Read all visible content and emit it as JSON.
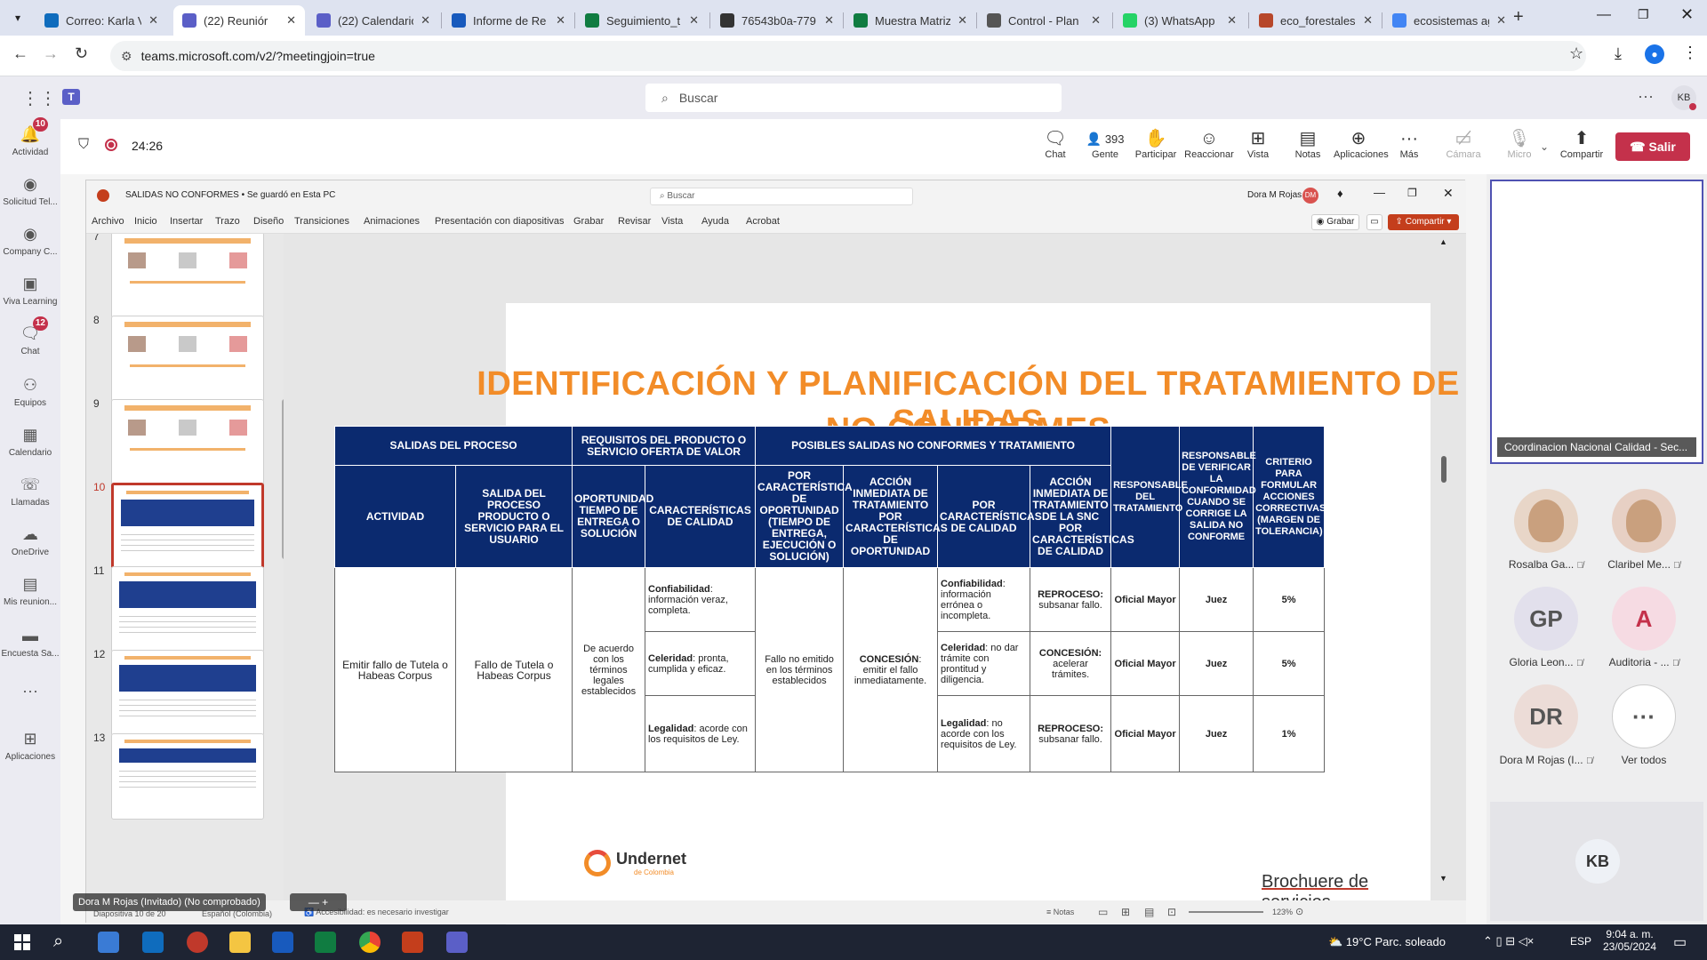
{
  "browser": {
    "tabs": [
      {
        "title": "Correo: Karla V",
        "color": "#0f6cbd",
        "active": false
      },
      {
        "title": "(22) Reuniór",
        "color": "#5b5fc7",
        "active": true
      },
      {
        "title": "(22) Calendario",
        "color": "#5b5fc7",
        "active": false
      },
      {
        "title": "Informe de Re",
        "color": "#185abd",
        "active": false
      },
      {
        "title": "Seguimiento_t",
        "color": "#107c41",
        "active": false
      },
      {
        "title": "76543b0a-779",
        "color": "#333333",
        "active": false
      },
      {
        "title": "Muestra Matriz",
        "color": "#107c41",
        "active": false
      },
      {
        "title": "Control - Plan",
        "color": "#555555",
        "active": false
      },
      {
        "title": "(3) WhatsApp",
        "color": "#25d366",
        "active": false
      },
      {
        "title": "eco_forestales",
        "color": "#b7472a",
        "active": false
      },
      {
        "title": "ecosistemas ag",
        "color": "#4285f4",
        "active": false
      }
    ],
    "url": "teams.microsoft.com/v2/?meetingjoin=true"
  },
  "teams": {
    "search_placeholder": "Buscar",
    "user_initials": "KB",
    "timer": "24:26",
    "rail": [
      {
        "label": "Actividad",
        "badge": "10",
        "icon": "bell-icon"
      },
      {
        "label": "Solicitud Tel...",
        "badge": "",
        "icon": "app-icon"
      },
      {
        "label": "Company C...",
        "badge": "",
        "icon": "app-icon"
      },
      {
        "label": "Viva Learning",
        "badge": "",
        "icon": "book-icon"
      },
      {
        "label": "Chat",
        "badge": "12",
        "icon": "chat-icon"
      },
      {
        "label": "Equipos",
        "badge": "",
        "icon": "teams-icon"
      },
      {
        "label": "Calendario",
        "badge": "",
        "icon": "calendar-icon"
      },
      {
        "label": "Llamadas",
        "badge": "",
        "icon": "phone-icon"
      },
      {
        "label": "OneDrive",
        "badge": "",
        "icon": "cloud-icon"
      },
      {
        "label": "Mis reunion...",
        "badge": "",
        "icon": "meeting-icon"
      },
      {
        "label": "Encuesta Sa...",
        "badge": "",
        "icon": "survey-icon"
      },
      {
        "label": "Aplicaciones",
        "badge": "",
        "icon": "plus-icon"
      }
    ],
    "controls": {
      "chat": "Chat",
      "people_count": "393",
      "people": "Gente",
      "raise": "Participar",
      "react": "Reaccionar",
      "view": "Vista",
      "notes": "Notas",
      "apps": "Aplicaciones",
      "more": "Más",
      "camera": "Cámara",
      "mic": "Micro",
      "share": "Compartir",
      "leave": "Salir"
    },
    "presenter_tile": "Coordinacion Nacional Calidad - Sec...",
    "participants": [
      {
        "name": "Rosalba Ga...",
        "initials": "",
        "bg": "#e8d6c8"
      },
      {
        "name": "Claribel Me...",
        "initials": "",
        "bg": "#e7d0c4"
      },
      {
        "name": "Gloria Leon...",
        "initials": "GP",
        "bg": "#e2e0ec"
      },
      {
        "name": "Auditoria - ...",
        "initials": "A",
        "bg": "#f6dbe3"
      },
      {
        "name": "Dora M Rojas (I...",
        "initials": "DR",
        "bg": "#ecdcd7"
      },
      {
        "name": "Ver todos",
        "initials": "···",
        "bg": "#ffffff"
      }
    ],
    "self_initials": "KB",
    "presenter_label": "Dora M Rojas (Invitado) (No comprobado)"
  },
  "ppt": {
    "title": "SALIDAS NO CONFORMES • Se guardó en Esta PC",
    "search_placeholder": "Buscar",
    "user": "Dora M Rojas",
    "user_initials": "DM",
    "record": "Grabar",
    "share": "Compartir",
    "menu": [
      "Archivo",
      "Inicio",
      "Insertar",
      "Trazo",
      "Diseño",
      "Transiciones",
      "Animaciones",
      "Presentación con diapositivas",
      "Grabar",
      "Revisar",
      "Vista",
      "Ayuda",
      "Acrobat"
    ],
    "thumb_numbers": [
      "7",
      "8",
      "9",
      "10",
      "11",
      "12",
      "13"
    ],
    "status_left": "Diapositiva 10 de 20",
    "status_lang": "Español (Colombia)",
    "status_access": "Accesibilidad: es necesario investigar",
    "status_notes": "Notas",
    "zoom": "123%"
  },
  "slide": {
    "title_line1": "IDENTIFICACIÓN  Y PLANIFICACIÓN DEL TRATAMIENTO DE SALIDAS",
    "title_line2": "NO CONFORMES",
    "logo": "Undernet",
    "logo_sub": "de Colombia",
    "footer": "Brochuere de servicios",
    "page": "10",
    "table": {
      "h_salidas": "SALIDAS DEL PROCESO",
      "h_req": "REQUISITOS DEL PRODUCTO O SERVICIO OFERTA DE VALOR",
      "h_pos": "POSIBLES SALIDAS NO CONFORMES Y TRATAMIENTO",
      "h_resp": "RESPONSABLE DEL TRATAMIENTO",
      "h_verif": "RESPONSABLE DE VERIFICAR LA CONFORMIDAD CUANDO SE CORRIGE LA SALIDA NO CONFORME",
      "h_crit": "CRITERIO PARA FORMULAR ACCIONES CORRECTIVAS (MARGEN DE TOLERANCIA)",
      "h_act": "ACTIVIDAD",
      "h_sal": "SALIDA DEL PROCESO PRODUCTO O SERVICIO PARA EL USUARIO",
      "h_op": "OPORTUNIDAD TIEMPO DE ENTREGA O SOLUCIÓN",
      "h_car": "CARACTERÍSTICAS DE CALIDAD",
      "h_pco": "POR CARACTERÍSTICA DE OPORTUNIDAD (TIEMPO DE ENTREGA, EJECUCIÓN O SOLUCIÓN)",
      "h_aco": "ACCIÓN INMEDIATA DE TRATAMIENTO POR CARACTERÍSTICAS DE OPORTUNIDAD",
      "h_pcc": "POR CARACTERÍSTICAS DE CALIDAD",
      "h_acc": "ACCIÓN INMEDIATA DE TRATAMIENTO DE LA SNC POR CARACTERÍSTICAS DE CALIDAD",
      "actividad": "Emitir fallo de Tutela o Habeas Corpus",
      "salida": "Fallo de Tutela o Habeas Corpus",
      "oportunidad": "De acuerdo con los términos legales establecidos",
      "por_oportunidad": "Fallo no emitido en los términos establecidos",
      "accion_op_b": "CONCESIÓN",
      "accion_op": ": emitir el fallo inmediatamente.",
      "rows": [
        {
          "car_b": "Confiabilidad",
          "car": ": información veraz, completa.",
          "pcc_b": "Confiabilidad",
          "pcc": ": información errónea o incompleta.",
          "acc_b": "REPROCESO:",
          "acc": "subsanar fallo.",
          "resp": "Oficial Mayor",
          "ver": "Juez",
          "crit": "5%"
        },
        {
          "car_b": "Celeridad",
          "car": ": pronta, cumplida y eficaz.",
          "pcc_b": "Celeridad",
          "pcc": ": no dar trámite con prontitud y diligencia.",
          "acc_b": "CONCESIÓN:",
          "acc": "acelerar trámites.",
          "resp": "Oficial Mayor",
          "ver": "Juez",
          "crit": "5%"
        },
        {
          "car_b": "Legalidad",
          "car": ": acorde con los requisitos de Ley.",
          "pcc_b": "Legalidad",
          "pcc": ": no acorde con los requisitos de Ley.",
          "acc_b": "REPROCESO:",
          "acc": "subsanar fallo.",
          "resp": "Oficial Mayor",
          "ver": "Juez",
          "crit": "1%"
        }
      ]
    }
  },
  "taskbar": {
    "weather": "19°C  Parc. soleado",
    "lang": "ESP",
    "time": "9:04 a. m.",
    "date": "23/05/2024"
  }
}
